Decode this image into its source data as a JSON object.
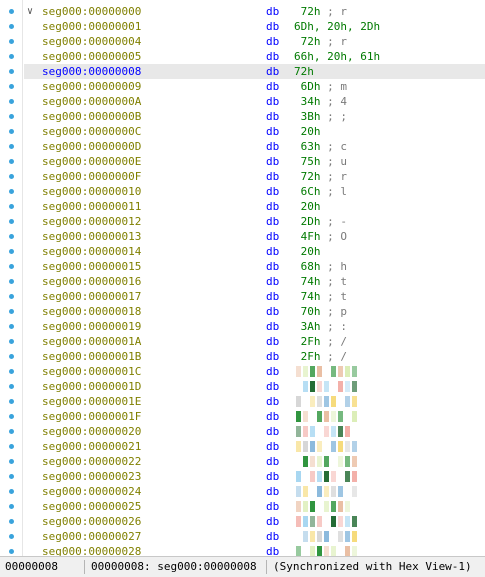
{
  "rows": [
    {
      "addr": "seg000:00000000",
      "mn": "db",
      "val": " 72h",
      "cmt": "; r",
      "chev": true
    },
    {
      "addr": "seg000:00000001",
      "mn": "db",
      "val": "6Dh, 20h, 2Dh",
      "cmt": ""
    },
    {
      "addr": "seg000:00000004",
      "mn": "db",
      "val": " 72h",
      "cmt": "; r"
    },
    {
      "addr": "seg000:00000005",
      "mn": "db",
      "val": "66h, 20h, 61h",
      "cmt": ""
    },
    {
      "addr": "seg000:00000008",
      "mn": "db",
      "val": "72h",
      "cmt": "",
      "selected": true
    },
    {
      "addr": "seg000:00000009",
      "mn": "db",
      "val": " 6Dh",
      "cmt": "; m"
    },
    {
      "addr": "seg000:0000000A",
      "mn": "db",
      "val": " 34h",
      "cmt": "; 4"
    },
    {
      "addr": "seg000:0000000B",
      "mn": "db",
      "val": " 3Bh",
      "cmt": "; ;"
    },
    {
      "addr": "seg000:0000000C",
      "mn": "db",
      "val": " 20h",
      "cmt": ""
    },
    {
      "addr": "seg000:0000000D",
      "mn": "db",
      "val": " 63h",
      "cmt": "; c"
    },
    {
      "addr": "seg000:0000000E",
      "mn": "db",
      "val": " 75h",
      "cmt": "; u"
    },
    {
      "addr": "seg000:0000000F",
      "mn": "db",
      "val": " 72h",
      "cmt": "; r"
    },
    {
      "addr": "seg000:00000010",
      "mn": "db",
      "val": " 6Ch",
      "cmt": "; l"
    },
    {
      "addr": "seg000:00000011",
      "mn": "db",
      "val": " 20h",
      "cmt": ""
    },
    {
      "addr": "seg000:00000012",
      "mn": "db",
      "val": " 2Dh",
      "cmt": "; -"
    },
    {
      "addr": "seg000:00000013",
      "mn": "db",
      "val": " 4Fh",
      "cmt": "; O"
    },
    {
      "addr": "seg000:00000014",
      "mn": "db",
      "val": " 20h",
      "cmt": ""
    },
    {
      "addr": "seg000:00000015",
      "mn": "db",
      "val": " 68h",
      "cmt": "; h"
    },
    {
      "addr": "seg000:00000016",
      "mn": "db",
      "val": " 74h",
      "cmt": "; t"
    },
    {
      "addr": "seg000:00000017",
      "mn": "db",
      "val": " 74h",
      "cmt": "; t"
    },
    {
      "addr": "seg000:00000018",
      "mn": "db",
      "val": " 70h",
      "cmt": "; p"
    },
    {
      "addr": "seg000:00000019",
      "mn": "db",
      "val": " 3Ah",
      "cmt": "; :"
    },
    {
      "addr": "seg000:0000001A",
      "mn": "db",
      "val": " 2Fh",
      "cmt": "; /"
    },
    {
      "addr": "seg000:0000001B",
      "mn": "db",
      "val": " 2Fh",
      "cmt": "; /"
    },
    {
      "addr": "seg000:0000001C",
      "mn": "db",
      "val": "",
      "cmt": "",
      "pixelated": true
    },
    {
      "addr": "seg000:0000001D",
      "mn": "db",
      "val": "",
      "cmt": "",
      "pixelated": true
    },
    {
      "addr": "seg000:0000001E",
      "mn": "db",
      "val": "",
      "cmt": "",
      "pixelated": true
    },
    {
      "addr": "seg000:0000001F",
      "mn": "db",
      "val": "",
      "cmt": "",
      "pixelated": true
    },
    {
      "addr": "seg000:00000020",
      "mn": "db",
      "val": "",
      "cmt": "",
      "pixelated": true
    },
    {
      "addr": "seg000:00000021",
      "mn": "db",
      "val": "",
      "cmt": "",
      "pixelated": true
    },
    {
      "addr": "seg000:00000022",
      "mn": "db",
      "val": "",
      "cmt": "",
      "pixelated": true
    },
    {
      "addr": "seg000:00000023",
      "mn": "db",
      "val": "",
      "cmt": "",
      "pixelated": true
    },
    {
      "addr": "seg000:00000024",
      "mn": "db",
      "val": "",
      "cmt": "",
      "pixelated": true
    },
    {
      "addr": "seg000:00000025",
      "mn": "db",
      "val": "",
      "cmt": "",
      "pixelated": true
    },
    {
      "addr": "seg000:00000026",
      "mn": "db",
      "val": "",
      "cmt": "",
      "pixelated": true
    },
    {
      "addr": "seg000:00000027",
      "mn": "db",
      "val": "",
      "cmt": "",
      "pixelated": true
    },
    {
      "addr": "seg000:00000028",
      "mn": "db",
      "val": "",
      "cmt": "",
      "pixelated": true
    }
  ],
  "status": {
    "offset": "00000008",
    "location": "00000008: seg000:00000008",
    "sync": "(Synchronized with Hex View-1)"
  },
  "colors": {
    "address": "#808000",
    "address_selected": "#0000ff",
    "mnemonic": "#0000ff",
    "operand": "#007a00",
    "comment": "#7a7a7a",
    "breakpoint_dot": "#39a3dc",
    "selected_row_bg": "#e8e8e8"
  },
  "icons": {
    "collapse": "chevron-down-icon",
    "gutter_marker": "dot-icon"
  }
}
